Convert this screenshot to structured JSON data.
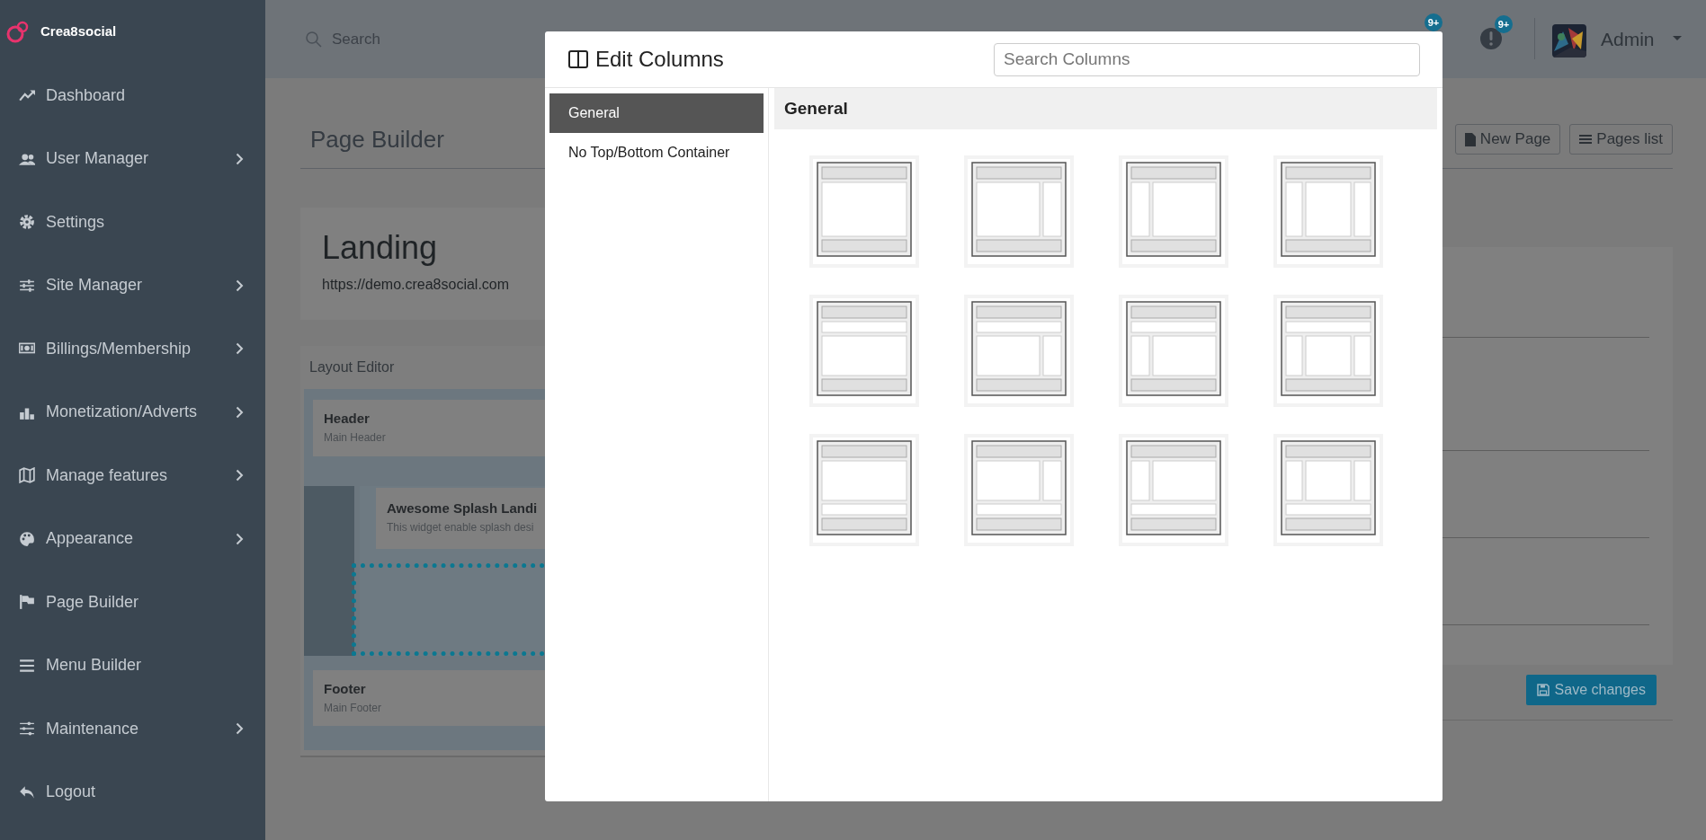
{
  "sidebar": {
    "brand": "Crea8social",
    "items": [
      {
        "label": "Dashboard",
        "has_submenu": false
      },
      {
        "label": "User Manager",
        "has_submenu": true
      },
      {
        "label": "Settings",
        "has_submenu": false
      },
      {
        "label": "Site Manager",
        "has_submenu": true
      },
      {
        "label": "Billings/Membership",
        "has_submenu": true
      },
      {
        "label": "Monetization/Adverts",
        "has_submenu": true
      },
      {
        "label": "Manage features",
        "has_submenu": true
      },
      {
        "label": "Appearance",
        "has_submenu": true
      },
      {
        "label": "Page Builder",
        "has_submenu": false
      },
      {
        "label": "Menu Builder",
        "has_submenu": false
      },
      {
        "label": "Maintenance",
        "has_submenu": true
      },
      {
        "label": "Logout",
        "has_submenu": false
      }
    ]
  },
  "topbar": {
    "search": {
      "placeholder": "Search"
    },
    "notification_badges": [
      "9+",
      "9+"
    ],
    "user": {
      "name": "Admin"
    }
  },
  "page": {
    "title": "Page Builder",
    "buttons": [
      {
        "kind": "new",
        "label": "New Page"
      },
      {
        "kind": "list",
        "label": "Pages list"
      }
    ],
    "landing": {
      "title": "Landing",
      "url": "https://demo.crea8social.com"
    },
    "layout_editor": {
      "title": "Layout Editor",
      "header_widget": {
        "title": "Header",
        "subtitle": "Main Header"
      },
      "content_widget": {
        "title": "Awesome Splash Landi",
        "subtitle": "This widget enable splash desi"
      },
      "footer_widget": {
        "title": "Footer",
        "subtitle": "Main Footer"
      }
    },
    "save_button": "Save changes"
  },
  "modal": {
    "title": "Edit Columns",
    "search": {
      "placeholder": "Search Columns"
    },
    "categories": [
      {
        "label": "General",
        "selected": true
      },
      {
        "label": "No Top/Bottom Container",
        "selected": false
      }
    ],
    "section_title": "General",
    "layouts": [
      {
        "kind": "full"
      },
      {
        "kind": "right"
      },
      {
        "kind": "left"
      },
      {
        "kind": "both"
      },
      {
        "kind": "topFull"
      },
      {
        "kind": "topRight"
      },
      {
        "kind": "topLeft"
      },
      {
        "kind": "topBoth"
      },
      {
        "kind": "bottomFull"
      },
      {
        "kind": "bottomRight"
      },
      {
        "kind": "bottomLeft"
      },
      {
        "kind": "bottomBoth"
      }
    ]
  }
}
